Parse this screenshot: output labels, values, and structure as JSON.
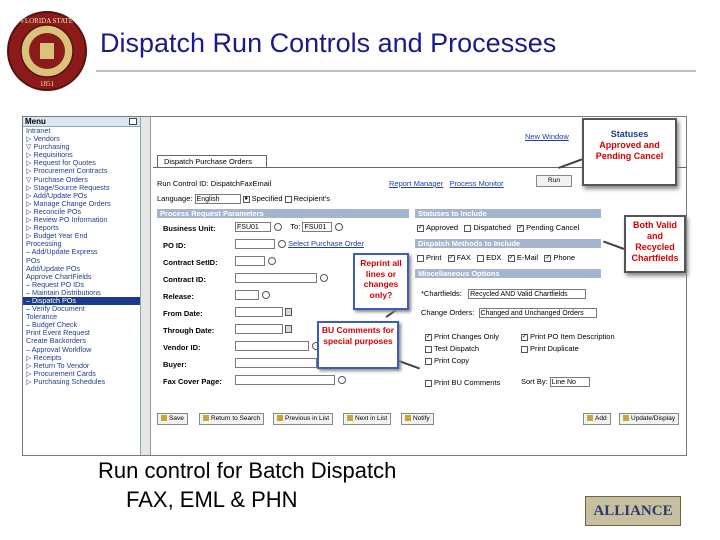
{
  "slide": {
    "title": "Dispatch Run Controls and Processes",
    "caption_line1": "Run control for Batch Dispatch",
    "caption_line2": "FAX, EML & PHN",
    "logo_text": "ALLIANCE"
  },
  "menu": {
    "title": "Menu",
    "items": [
      {
        "label": "Intranet",
        "selected": false
      },
      {
        "label": "▷ Vendors",
        "selected": false
      },
      {
        "label": "▽ Purchasing",
        "selected": false
      },
      {
        "label": "  ▷ Requisitions",
        "selected": false
      },
      {
        "label": "  ▷ Request for Quotes",
        "selected": false
      },
      {
        "label": "  ▷ Procurement Contracts",
        "selected": false
      },
      {
        "label": "  ▽ Purchase Orders",
        "selected": false
      },
      {
        "label": "    ▷ Stage/Source Requests",
        "selected": false
      },
      {
        "label": "    ▷ Add/Update POs",
        "selected": false
      },
      {
        "label": "    ▷ Manage Change Orders",
        "selected": false
      },
      {
        "label": "    ▷ Reconcile POs",
        "selected": false
      },
      {
        "label": "    ▷ Review PO Information",
        "selected": false
      },
      {
        "label": "    ▷ Reports",
        "selected": false
      },
      {
        "label": "    ▷ Budget Year End",
        "selected": false
      },
      {
        "label": "      Processing",
        "selected": false
      },
      {
        "label": "    – Add/Update Express",
        "selected": false
      },
      {
        "label": "      POs",
        "selected": false
      },
      {
        "label": "      Add/Update POs",
        "selected": false
      },
      {
        "label": "      Approve ChartFields",
        "selected": false
      },
      {
        "label": "    – Request PO IDs",
        "selected": false
      },
      {
        "label": "    – Maintain Distributions",
        "selected": false
      },
      {
        "label": "    – Dispatch POs",
        "selected": true
      },
      {
        "label": "    – Verify Document",
        "selected": false
      },
      {
        "label": "      Tolerance",
        "selected": false
      },
      {
        "label": "    – Budget Check",
        "selected": false
      },
      {
        "label": "      Print Event Request",
        "selected": false
      },
      {
        "label": "      Create Backorders",
        "selected": false
      },
      {
        "label": "    – Approval Workflow",
        "selected": false
      },
      {
        "label": "▷ Receipts",
        "selected": false
      },
      {
        "label": "▷ Return To Vendor",
        "selected": false
      },
      {
        "label": "▷ Procurement Cards",
        "selected": false
      },
      {
        "label": "▷ Purchasing Schedules",
        "selected": false
      }
    ]
  },
  "page": {
    "new_window": "New Window",
    "tab_label": "Dispatch Purchase Orders",
    "run_control_label": "Run Control ID:",
    "run_control_value": "DispatchFaxEmail",
    "report_manager": "Report Manager",
    "process_monitor": "Process Monitor",
    "run_button": "Run",
    "language_label": "Language:",
    "language_value": "English",
    "specified_label": "Specified",
    "recipients_label": "Recipient's",
    "section_params": "Process Request Parameters",
    "business_unit_label": "Business Unit:",
    "business_unit_value": "FSU01",
    "to_label": "To:",
    "to_value": "FSU01",
    "po_id_label": "PO ID:",
    "select_po_link": "Select Purchase Order",
    "contract_setid_label": "Contract SetID:",
    "contract_id_label": "Contract ID:",
    "release_label": "Release:",
    "from_date_label": "From Date:",
    "through_date_label": "Through Date:",
    "vendor_id_label": "Vendor ID:",
    "buyer_label": "Buyer:",
    "fax_cover_label": "Fax Cover Page:",
    "section_statuses": "Statuses to Include",
    "status_approved": "Approved",
    "status_dispatched": "Dispatched",
    "status_pending_cancel": "Pending Cancel",
    "section_methods": "Dispatch Methods to Include",
    "method_print": "Print",
    "method_fax": "FAX",
    "method_edx": "EDX",
    "method_email": "E-Mail",
    "method_phone": "Phone",
    "section_misc": "Miscellaneous Options",
    "chartfields_label": "*Chartfields:",
    "chartfields_value": "Recycled AND Valid Chartfields",
    "change_orders_label": "Change Orders:",
    "change_orders_value": "Changed and Unchanged Orders",
    "print_changes_only": "Print Changes Only",
    "print_po_item_desc": "Print PO Item Description",
    "test_dispatch": "Test Dispatch",
    "print_duplicate": "Print Duplicate",
    "print_copy": "Print Copy",
    "print_bu_comments": "Print BU Comments",
    "sort_by_label": "Sort By:",
    "sort_by_value": "Line No",
    "btn_save": "Save",
    "btn_return_search": "Return to Search",
    "btn_prev": "Previous in List",
    "btn_next": "Next in List",
    "btn_notify": "Notify",
    "btn_add": "Add",
    "btn_update": "Update/Display"
  },
  "callouts": {
    "statuses_title": "Statuses",
    "statuses_body": "Approved and Pending Cancel",
    "both_valid": "Both Valid and Recycled Chartfields",
    "reprint": "Reprint all lines or changes only?",
    "bu_comments": "BU Comments for special purposes"
  }
}
